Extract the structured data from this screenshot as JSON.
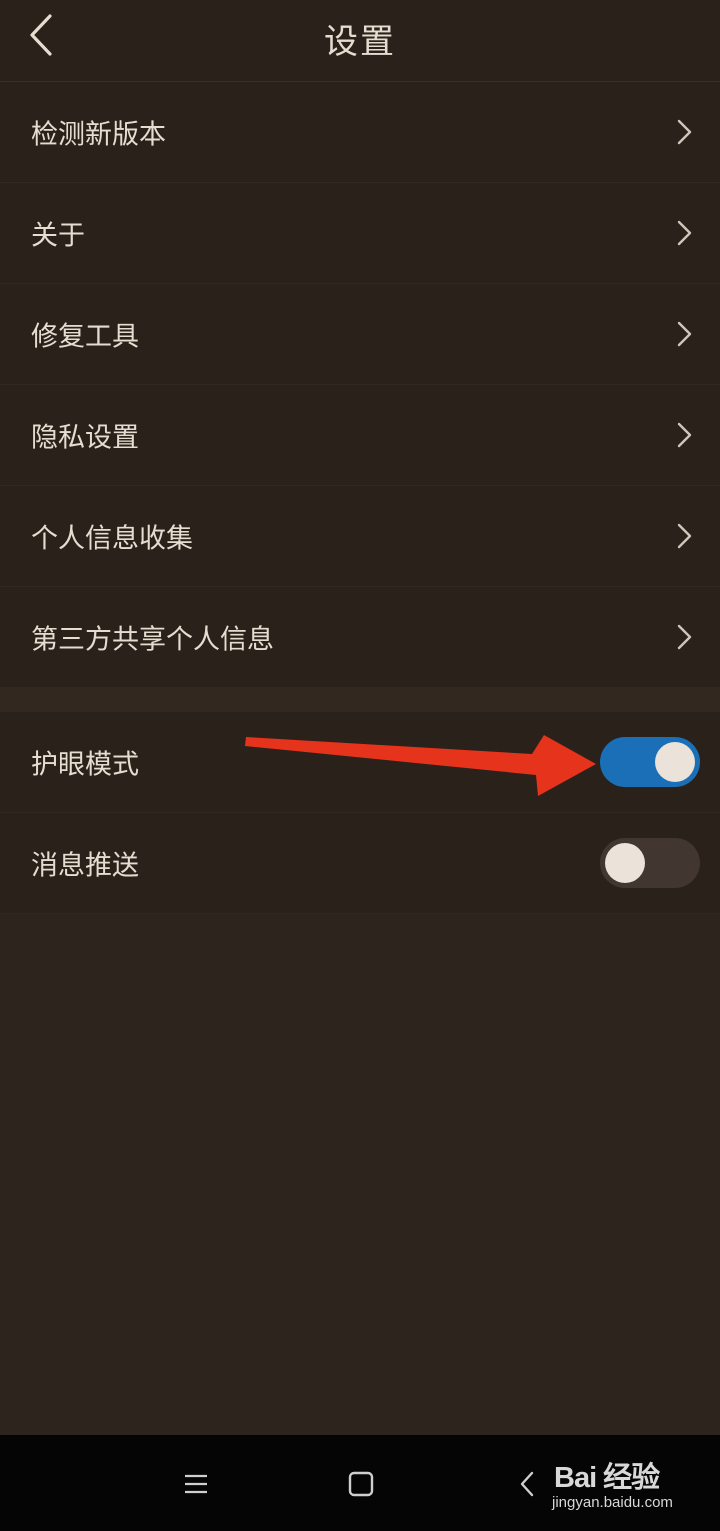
{
  "header": {
    "title": "设置",
    "back_icon": "chevron-left-icon"
  },
  "menu": {
    "items": [
      {
        "label": "检测新版本"
      },
      {
        "label": "关于"
      },
      {
        "label": "修复工具"
      },
      {
        "label": "隐私设置"
      },
      {
        "label": "个人信息收集"
      },
      {
        "label": "第三方共享个人信息"
      }
    ]
  },
  "toggles": {
    "items": [
      {
        "label": "护眼模式",
        "state": "on"
      },
      {
        "label": "消息推送",
        "state": "off"
      }
    ]
  },
  "colors": {
    "background": "#2d241d",
    "toggle_on": "#1b6fb6",
    "toggle_off": "#413730",
    "annotation_arrow": "#e5331c"
  },
  "navbar": {
    "icons": [
      "menu-icon",
      "home-square-icon",
      "back-icon"
    ]
  },
  "watermark": {
    "logo_text": "Bai 经验",
    "url": "jingyan.baidu.com"
  }
}
